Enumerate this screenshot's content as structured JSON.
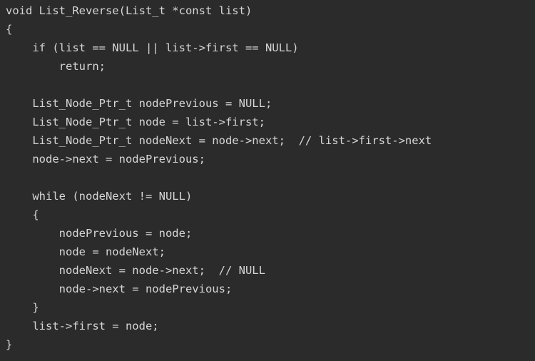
{
  "editor": {
    "background_color": "#2b2b2b",
    "text_color": "#d6d6d6",
    "lines": [
      "void List_Reverse(List_t *const list)",
      "{",
      "    if (list == NULL || list->first == NULL)",
      "        return;",
      "",
      "    List_Node_Ptr_t nodePrevious = NULL;",
      "    List_Node_Ptr_t node = list->first;",
      "    List_Node_Ptr_t nodeNext = node->next;  // list->first->next",
      "    node->next = nodePrevious;",
      "",
      "    while (nodeNext != NULL)",
      "    {",
      "        nodePrevious = node;",
      "        node = nodeNext;",
      "        nodeNext = node->next;  // NULL",
      "        node->next = nodePrevious;",
      "    }",
      "    list->first = node;",
      "}"
    ]
  }
}
